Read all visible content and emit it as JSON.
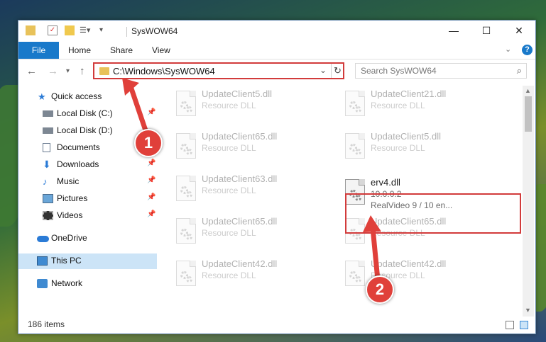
{
  "window": {
    "title": "SysWOW64"
  },
  "ribbon": {
    "tabs": [
      "File",
      "Home",
      "Share",
      "View"
    ]
  },
  "address": {
    "path": "C:\\Windows\\SysWOW64"
  },
  "search": {
    "placeholder": "Search SysWOW64"
  },
  "sidebar": {
    "items": [
      {
        "label": "Quick access",
        "icon": "star-icon",
        "pinned": false
      },
      {
        "label": "Local Disk (C:)",
        "icon": "drive-icon",
        "pinned": true
      },
      {
        "label": "Local Disk (D:)",
        "icon": "drive-icon",
        "pinned": false
      },
      {
        "label": "Documents",
        "icon": "documents-icon",
        "pinned": true
      },
      {
        "label": "Downloads",
        "icon": "download-icon",
        "pinned": true
      },
      {
        "label": "Music",
        "icon": "music-icon",
        "pinned": true
      },
      {
        "label": "Pictures",
        "icon": "pictures-icon",
        "pinned": true
      },
      {
        "label": "Videos",
        "icon": "videos-icon",
        "pinned": true
      },
      {
        "label": "OneDrive",
        "icon": "cloud-icon",
        "pinned": false
      },
      {
        "label": "This PC",
        "icon": "computer-icon",
        "pinned": false,
        "selected": true
      },
      {
        "label": "Network",
        "icon": "network-icon",
        "pinned": false
      }
    ]
  },
  "files": {
    "left": [
      {
        "name": "UpdateClient5.dll",
        "sub": "Resource DLL"
      },
      {
        "name": "UpdateClient65.dll",
        "sub": "Resource DLL"
      },
      {
        "name": "UpdateClient63.dll",
        "sub": "Resource DLL"
      },
      {
        "name": "UpdateClient65.dll",
        "sub": "Resource DLL"
      },
      {
        "name": "UpdateClient42.dll",
        "sub": "Resource DLL"
      }
    ],
    "right": [
      {
        "name": "UpdateClient21.dll",
        "sub": "Resource DLL"
      },
      {
        "name": "UpdateClient5.dll",
        "sub": "Resource DLL"
      },
      {
        "name": "erv4.dll",
        "version": "10.0.0.2",
        "description": "RealVideo 9 / 10 en..."
      },
      {
        "name": "UpdateClient65.dll",
        "sub": "Resource DLL"
      },
      {
        "name": "UpdateClient42.dll",
        "sub": "Resource DLL"
      }
    ]
  },
  "status": {
    "item_count": "186 items"
  },
  "annotations": {
    "step1": "1",
    "step2": "2",
    "color": "#e0403a"
  }
}
